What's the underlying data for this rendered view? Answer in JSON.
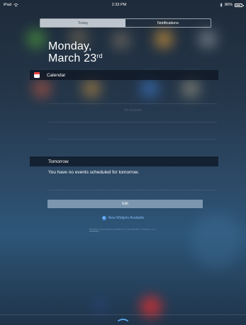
{
  "status_bar": {
    "device": "iPad",
    "time": "2:33 PM",
    "battery": "86%",
    "battery_level": 0.86
  },
  "tabs": [
    {
      "label": "Today",
      "selected": true
    },
    {
      "label": "Notifications",
      "selected": false
    }
  ],
  "date": {
    "weekday": "Monday,",
    "month_day": "March 23",
    "suffix": "rd"
  },
  "calendar": {
    "title": "Calendar",
    "empty_text": "No Events",
    "icon": "calendar-icon"
  },
  "tomorrow": {
    "title": "Tomorrow",
    "message": "You have no events scheduled for tomorrow."
  },
  "edit_label": "Edit",
  "new_widgets_label": "New Widgets Available",
  "attribution": {
    "link": "Weather",
    "text": "information provided by The Weather Channel, LLC."
  },
  "colors": {
    "accent": "#4a95e8",
    "calendar_red": "#f23e3e"
  }
}
